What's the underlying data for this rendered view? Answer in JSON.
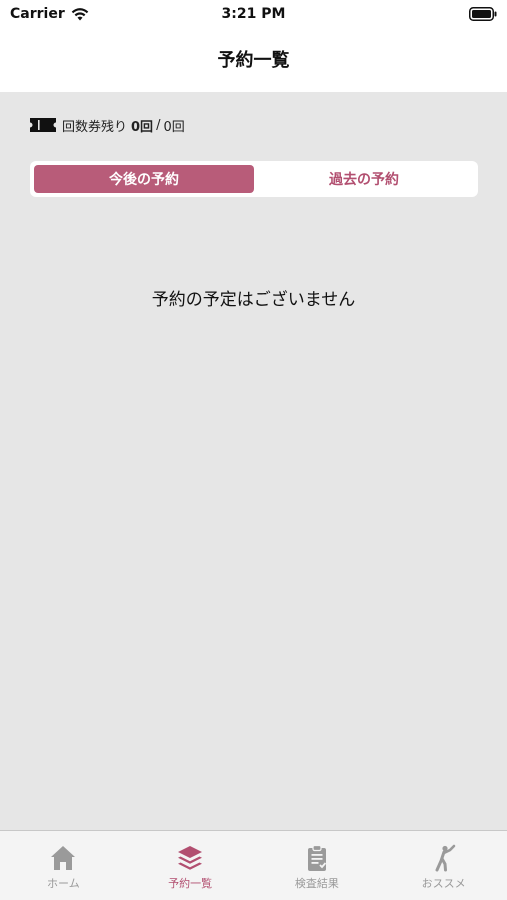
{
  "status_bar": {
    "carrier": "Carrier",
    "time": "3:21 PM"
  },
  "nav": {
    "title": "予約一覧"
  },
  "tickets": {
    "label": "回数券残り",
    "remaining": "0回",
    "separator": "/",
    "total": "0回"
  },
  "segments": {
    "upcoming": "今後の予約",
    "past": "過去の予約",
    "selected": "upcoming"
  },
  "empty_message": "予約の予定はございません",
  "tab_bar": {
    "items": [
      {
        "label": "ホーム",
        "icon": "home-icon",
        "active": false
      },
      {
        "label": "予約一覧",
        "icon": "layers-icon",
        "active": true
      },
      {
        "label": "検査結果",
        "icon": "clipboard-icon",
        "active": false
      },
      {
        "label": "おススメ",
        "icon": "stretching-person-icon",
        "active": false
      }
    ]
  },
  "colors": {
    "accent": "#b24f70",
    "accent_fill": "#b85c79",
    "inactive_tab": "#9a9a9a",
    "background": "#e6e6e6"
  }
}
